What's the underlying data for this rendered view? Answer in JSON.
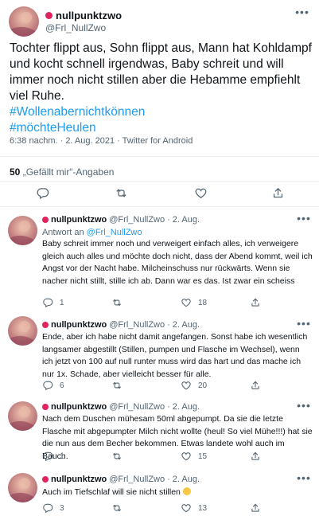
{
  "main_tweet": {
    "display_name": "nullpunktzwo",
    "handle": "@Frl_NullZwo",
    "text": "Tochter flippt aus, Sohn flippt aus, Mann hat Kohldampf und kocht schnell irgendwas, Baby schreit und will immer noch nicht stillen aber die Hebamme empfiehlt viel Ruhe.",
    "hashtags": [
      "#Wollenabernichtkönnen",
      "#möchteHeulen"
    ],
    "timestamp": "6:38 nachm. · 2. Aug. 2021 · Twitter for Android",
    "likes_count": "50",
    "likes_label": "„Gefällt mir“-Angaben"
  },
  "icons": {
    "more": "more-dots-icon",
    "reply": "speech-bubble-icon",
    "retweet": "retweet-arrows-icon",
    "like": "heart-icon",
    "share": "share-icon",
    "status_dot": "red-circle-emoji"
  },
  "colors": {
    "accent": "#1d9bf0",
    "status_dot": "#e0245e",
    "secondary_text": "#536471"
  },
  "replies": [
    {
      "display_name": "nullpunktzwo",
      "handle": "@Frl_NullZwo",
      "sep": "·",
      "time": "2. Aug.",
      "reply_to_prefix": "Antwort an",
      "reply_to_handle": "@Frl_NullZwo",
      "text": "Baby schreit immer noch und verweigert einfach alles, ich verweigere gleich auch alles und möchte doch nicht, dass der Abend kommt, weil ich Angst vor der Nacht habe. Milcheinschuss nur rückwärts. Wenn sie nacher nicht stillt, stille ich ab. Dann war es das. Ist zwar ein scheiss",
      "reply_count": "1",
      "retweet_count": "",
      "like_count": "18"
    },
    {
      "display_name": "nullpunktzwo",
      "handle": "@Frl_NullZwo",
      "sep": "·",
      "time": "2. Aug.",
      "text": "Ende, aber ich habe nicht damit angefangen. Sonst habe ich wesentlich langsamer abgestillt (Stillen, pumpen und Flasche im Wechsel), wenn ich jetzt von 100 auf null runter muss wird das hart und das mache ich nur 1x. Schade, aber vielleicht besser für alle.",
      "reply_count": "6",
      "retweet_count": "",
      "like_count": "20"
    },
    {
      "display_name": "nullpunktzwo",
      "handle": "@Frl_NullZwo",
      "sep": "·",
      "time": "2. Aug.",
      "text": "Nach dem Duschen mühesam 50ml abgepumpt. Da sie die letzte Flasche mit abgepumpter Milch nicht wollte (heul! So viel Mühe!!!) hat sie die nun aus dem Becher bekommen. Etwas landete wohl auch im Bauch.",
      "reply_count": "1",
      "retweet_count": "",
      "like_count": "15"
    },
    {
      "display_name": "nullpunktzwo",
      "handle": "@Frl_NullZwo",
      "sep": "·",
      "time": "2. Aug.",
      "text": "Auch im Tiefschlaf will sie nicht stillen",
      "reply_count": "3",
      "retweet_count": "",
      "like_count": "13"
    }
  ]
}
